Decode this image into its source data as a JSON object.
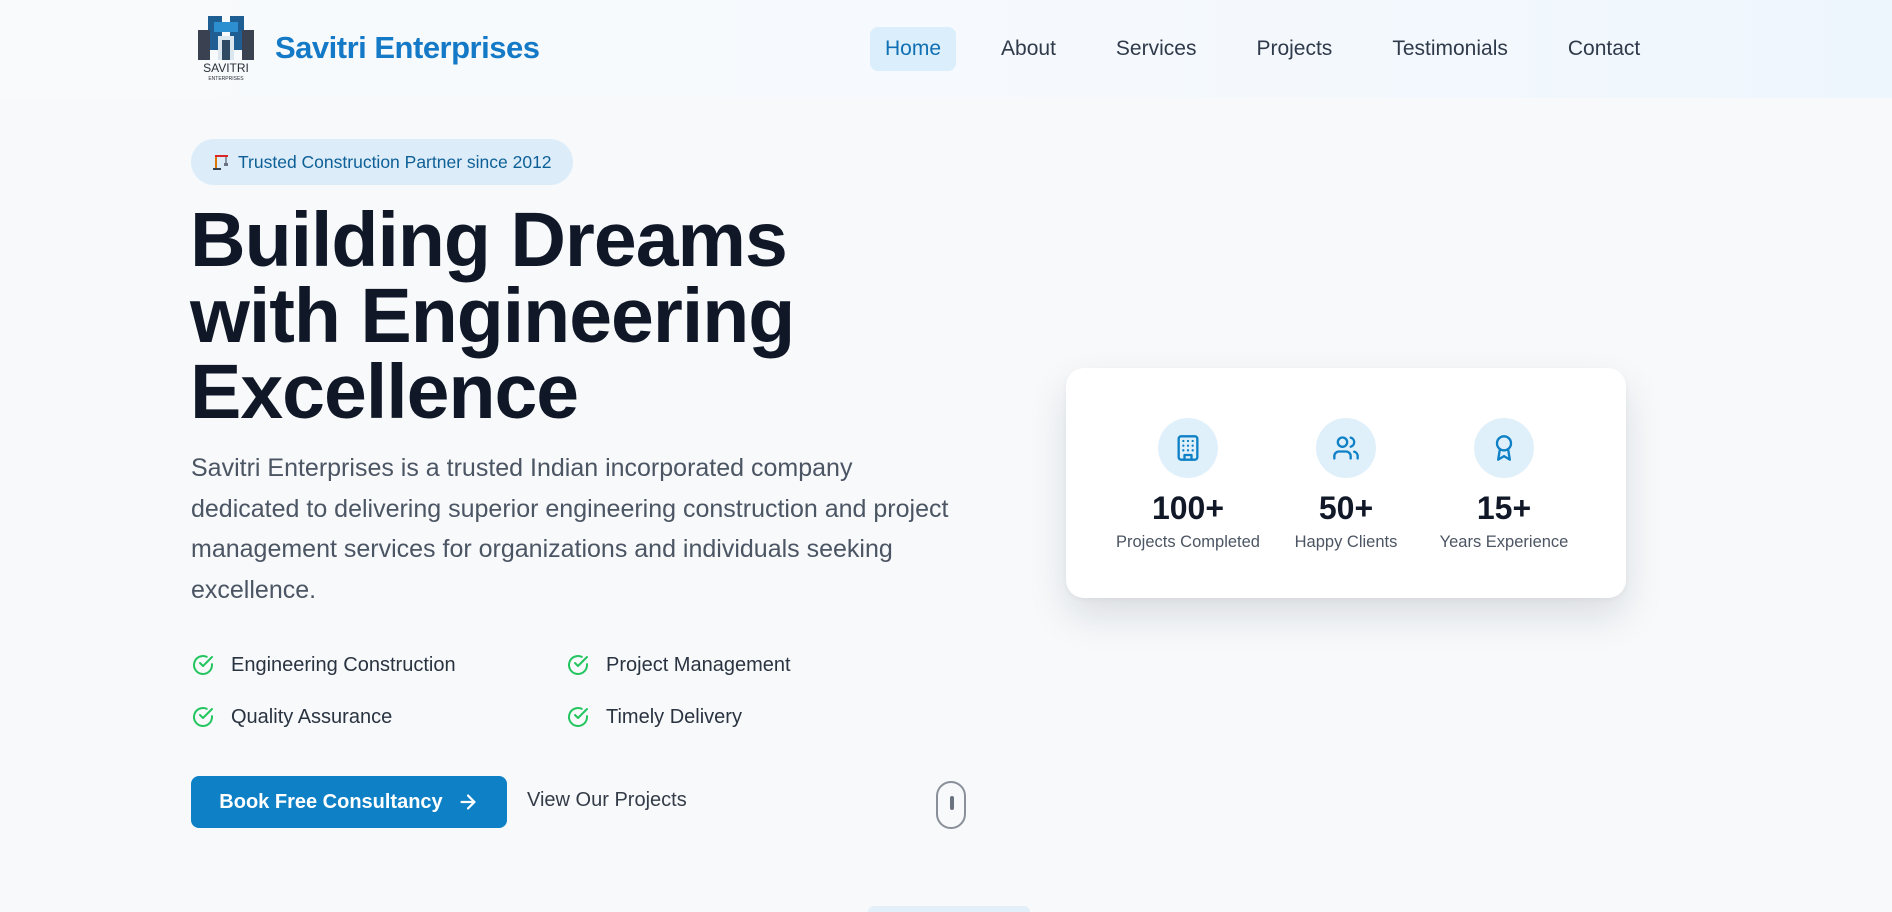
{
  "header": {
    "logo_text": "SAVITRI",
    "logo_subtext": "ENTERPRISES",
    "brand": "Savitri Enterprises",
    "nav": [
      {
        "label": "Home",
        "active": true
      },
      {
        "label": "About"
      },
      {
        "label": "Services"
      },
      {
        "label": "Projects"
      },
      {
        "label": "Testimonials"
      },
      {
        "label": "Contact"
      }
    ]
  },
  "hero": {
    "badge": "Trusted Construction Partner since 2012",
    "badge_icon": "crane-icon",
    "headline": "Building Dreams with Engineering Excellence",
    "description": "Savitri Enterprises is a trusted Indian incorporated company dedicated to delivering superior engineering construction and project management services for organizations and individuals seeking excellence.",
    "features": [
      "Engineering Construction",
      "Project Management",
      "Quality Assurance",
      "Timely Delivery"
    ],
    "cta_primary": "Book Free Consultancy",
    "cta_secondary": "View Our Projects"
  },
  "stats": [
    {
      "icon": "building-icon",
      "value": "100+",
      "label": "Projects Completed"
    },
    {
      "icon": "users-icon",
      "value": "50+",
      "label": "Happy Clients"
    },
    {
      "icon": "award-icon",
      "value": "15+",
      "label": "Years Experience"
    }
  ],
  "colors": {
    "accent": "#0d80c6",
    "brand": "#1479c6",
    "check": "#22c55e",
    "badge_bg": "#dcedf9"
  }
}
